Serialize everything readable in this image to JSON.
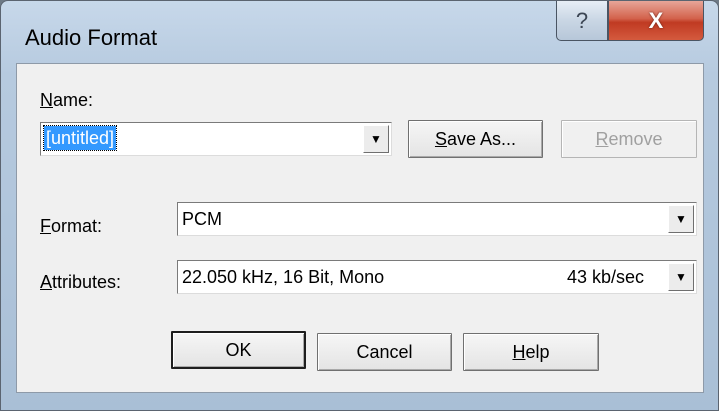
{
  "window": {
    "title": "Audio Format",
    "help_glyph": "?",
    "close_glyph": "X"
  },
  "name": {
    "label": "Name:",
    "value": "[untitled]",
    "save_as_label": "Save As...",
    "remove_label": "Remove"
  },
  "format": {
    "label": "Format:",
    "value": "PCM"
  },
  "attributes": {
    "label": "Attributes:",
    "value": "22.050 kHz, 16 Bit, Mono",
    "rate": "43 kb/sec"
  },
  "buttons": {
    "ok": "OK",
    "cancel": "Cancel",
    "help": "Help"
  },
  "icons": {
    "dropdown": "chevron-down-icon"
  }
}
